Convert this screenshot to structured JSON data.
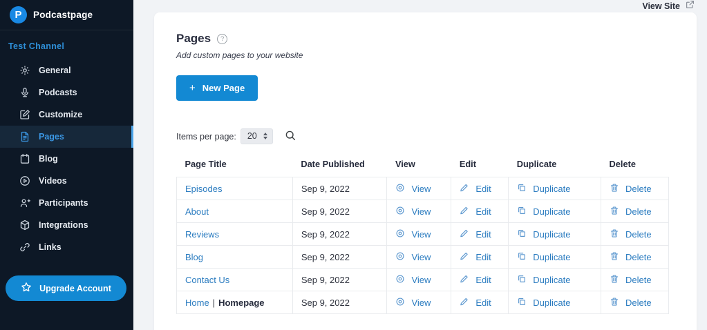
{
  "brand": {
    "name": "Podcastpage",
    "logo_letter": "P"
  },
  "sidebar": {
    "channel_label": "Test Channel",
    "items": [
      {
        "label": "General",
        "icon": "gear-icon",
        "selected": false
      },
      {
        "label": "Podcasts",
        "icon": "microphone-icon",
        "selected": false
      },
      {
        "label": "Customize",
        "icon": "customize-icon",
        "selected": false
      },
      {
        "label": "Pages",
        "icon": "page-icon",
        "selected": true
      },
      {
        "label": "Blog",
        "icon": "blog-icon",
        "selected": false
      },
      {
        "label": "Videos",
        "icon": "video-icon",
        "selected": false
      },
      {
        "label": "Participants",
        "icon": "participants-icon",
        "selected": false
      },
      {
        "label": "Integrations",
        "icon": "integrations-icon",
        "selected": false
      },
      {
        "label": "Links",
        "icon": "links-icon",
        "selected": false
      }
    ],
    "upgrade_label": "Upgrade Account"
  },
  "header": {
    "view_site_label": "View Site"
  },
  "page": {
    "title": "Pages",
    "help_glyph": "?",
    "subtitle": "Add custom pages to your website",
    "new_page": {
      "plus": "+",
      "label": "New Page"
    }
  },
  "controls": {
    "items_per_page_label": "Items per page:",
    "items_per_page_value": "20"
  },
  "table": {
    "columns": [
      "Page Title",
      "Date Published",
      "View",
      "Edit",
      "Duplicate",
      "Delete"
    ],
    "actions": {
      "view": "View",
      "edit": "Edit",
      "duplicate": "Duplicate",
      "delete": "Delete"
    },
    "rows": [
      {
        "title": "Episodes",
        "date": "Sep 9, 2022"
      },
      {
        "title": "About",
        "date": "Sep 9, 2022"
      },
      {
        "title": "Reviews",
        "date": "Sep 9, 2022"
      },
      {
        "title": "Blog",
        "date": "Sep 9, 2022"
      },
      {
        "title": "Contact Us",
        "date": "Sep 9, 2022"
      },
      {
        "title": "Home",
        "separator": "|",
        "suffix": "Homepage",
        "date": "Sep 9, 2022"
      }
    ]
  },
  "colors": {
    "accent_blue": "#1389d3",
    "link_blue": "#2b7cc0",
    "sidebar_bg": "#0d1826",
    "selected_item_bg": "#16283a",
    "selected_item_bar": "#4aa3e8",
    "page_bg": "#f1f3f6",
    "card_bg": "#ffffff"
  }
}
